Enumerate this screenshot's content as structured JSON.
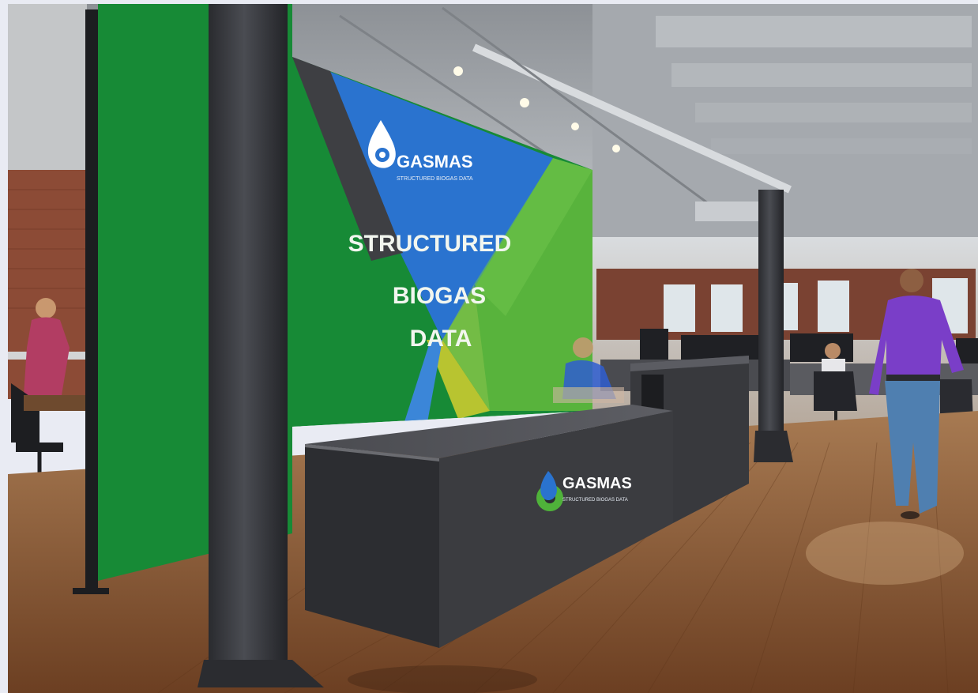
{
  "wall_sign": {
    "brand": "GASMAS",
    "tagline": "STRUCTURED BIOGAS DATA",
    "headline": [
      "STRUCTURED",
      "BIOGAS",
      "DATA"
    ]
  },
  "desk_sign": {
    "brand": "GASMAS",
    "tagline": "STRUCTURED BIOGAS DATA"
  },
  "colors": {
    "brand_green": "#178a36",
    "brand_blue": "#2a73cf",
    "light_green": "#58b33c",
    "charcoal": "#3b3c40",
    "floor": "#8a5a36"
  }
}
